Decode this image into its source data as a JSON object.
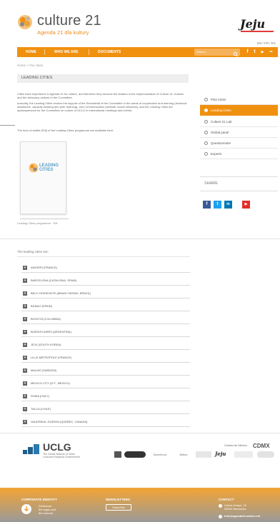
{
  "header": {
    "brand_title": "culture 21",
    "brand_subtitle": "Agenda 21 dla kultury",
    "partner_logo": "Jeju",
    "language_switch": "EN / FR / ES"
  },
  "nav": {
    "items": [
      {
        "label": "HOME"
      },
      {
        "label": "WHO WE ARE"
      },
      {
        "label": "DOCUMENTS"
      }
    ],
    "search_placeholder": "Search",
    "search_icon": "magnifier",
    "social": [
      {
        "name": "facebook",
        "glyph": "f"
      },
      {
        "name": "twitter",
        "glyph": "t"
      },
      {
        "name": "youtube",
        "glyph": "▶"
      },
      {
        "name": "flickr",
        "glyph": "••"
      }
    ]
  },
  "breadcrumb": "Home > Our cities",
  "page_title": "LEADING CITIES",
  "intro": {
    "p1": "Cities have experience in Agenda 21 for culture, and therefore they become the leaders in the implementation of Culture 21: Actions and the advocacy actions of the Committee.",
    "p2": "Annually, the Leading Cities receive the support of the Secretariat of the Committee in the areas of cooperation and learning (technical assistance, capacity building and peer learning), and Communication (website, social networks), and the Leading Cities are spokespersons for the Committee on culture of UCLG in international meetings and events.",
    "p3": "The form of leaflet (Pdf) of the Leading Cities programme are available here:"
  },
  "cover": {
    "title_line1": "LEADING",
    "title_line2": "CITIES",
    "caption": "Leading Cities programme · Pdf"
  },
  "sidebar": {
    "items": [
      {
        "label": "Pilot Cities",
        "active": false
      },
      {
        "label": "Leading Cities",
        "active": true
      },
      {
        "label": "Culture 21 Lab",
        "active": false
      },
      {
        "label": "Global panel",
        "active": false
      },
      {
        "label": "Questionnaire",
        "active": false
      },
      {
        "label": "Experts",
        "active": false
      }
    ],
    "share_title": "SHARE",
    "share_buttons": [
      {
        "name": "facebook",
        "glyph": "f",
        "color": "#3b5998"
      },
      {
        "name": "twitter",
        "glyph": "t",
        "color": "#1da1f2"
      },
      {
        "name": "linkedin",
        "glyph": "in",
        "color": "#0077b5"
      },
      {
        "name": "youtube",
        "glyph": "▶",
        "color": "#e52d27"
      }
    ]
  },
  "cities": {
    "title": "The leading cities are:",
    "items": [
      "ANGERS (FRANCE)",
      "BARCELONA (CATALONIA, SPAIN)",
      "BELO HORIZONTE (MINAS GERAIS, BRAZIL)",
      "BILBAO (SPAIN)",
      "BOGOTÁ (COLOMBIA)",
      "BUENOS AIRES (ARGENTINA)",
      "JEJU (SOUTH KOREA)",
      "LILLE-MÉTROPOLE (FRANCE)",
      "MALMÖ (SWEDEN)",
      "MEXICO CITY (D.F., MEXICO)",
      "ROMA (ITALY)",
      "TALCA (CHILE)",
      "VAUDREUIL-DORION (QUEBEC, CANADA)"
    ]
  },
  "footer": {
    "uclg_name": "UCLG",
    "uclg_sub_1": "The Global Network of Cities,",
    "uclg_sub_2": "Local and Regional Governments",
    "cdmx_pre": "Ciudad de México",
    "cdmx": "CDMX",
    "partners_small": [
      "Barcelona",
      "Bilbao",
      "Jeju"
    ],
    "col1_title": "CORPORATE IDENTITY",
    "col1_text_1": "Download",
    "col1_text_2": "the logos and",
    "col1_text_3": "the manual",
    "col2_title": "NEWSLETTERS",
    "col2_button": "Subscribe",
    "col3_title": "CONTACT",
    "col3_addr_1": "Carrer Avinyó, 15",
    "col3_addr_2": "08002 Barcelona",
    "col3_email": "info@agenda21culture.net"
  },
  "colors": {
    "accent": "#f0900f",
    "nav_bg": "#f0900f",
    "sidebar_active": "#f0900f"
  }
}
